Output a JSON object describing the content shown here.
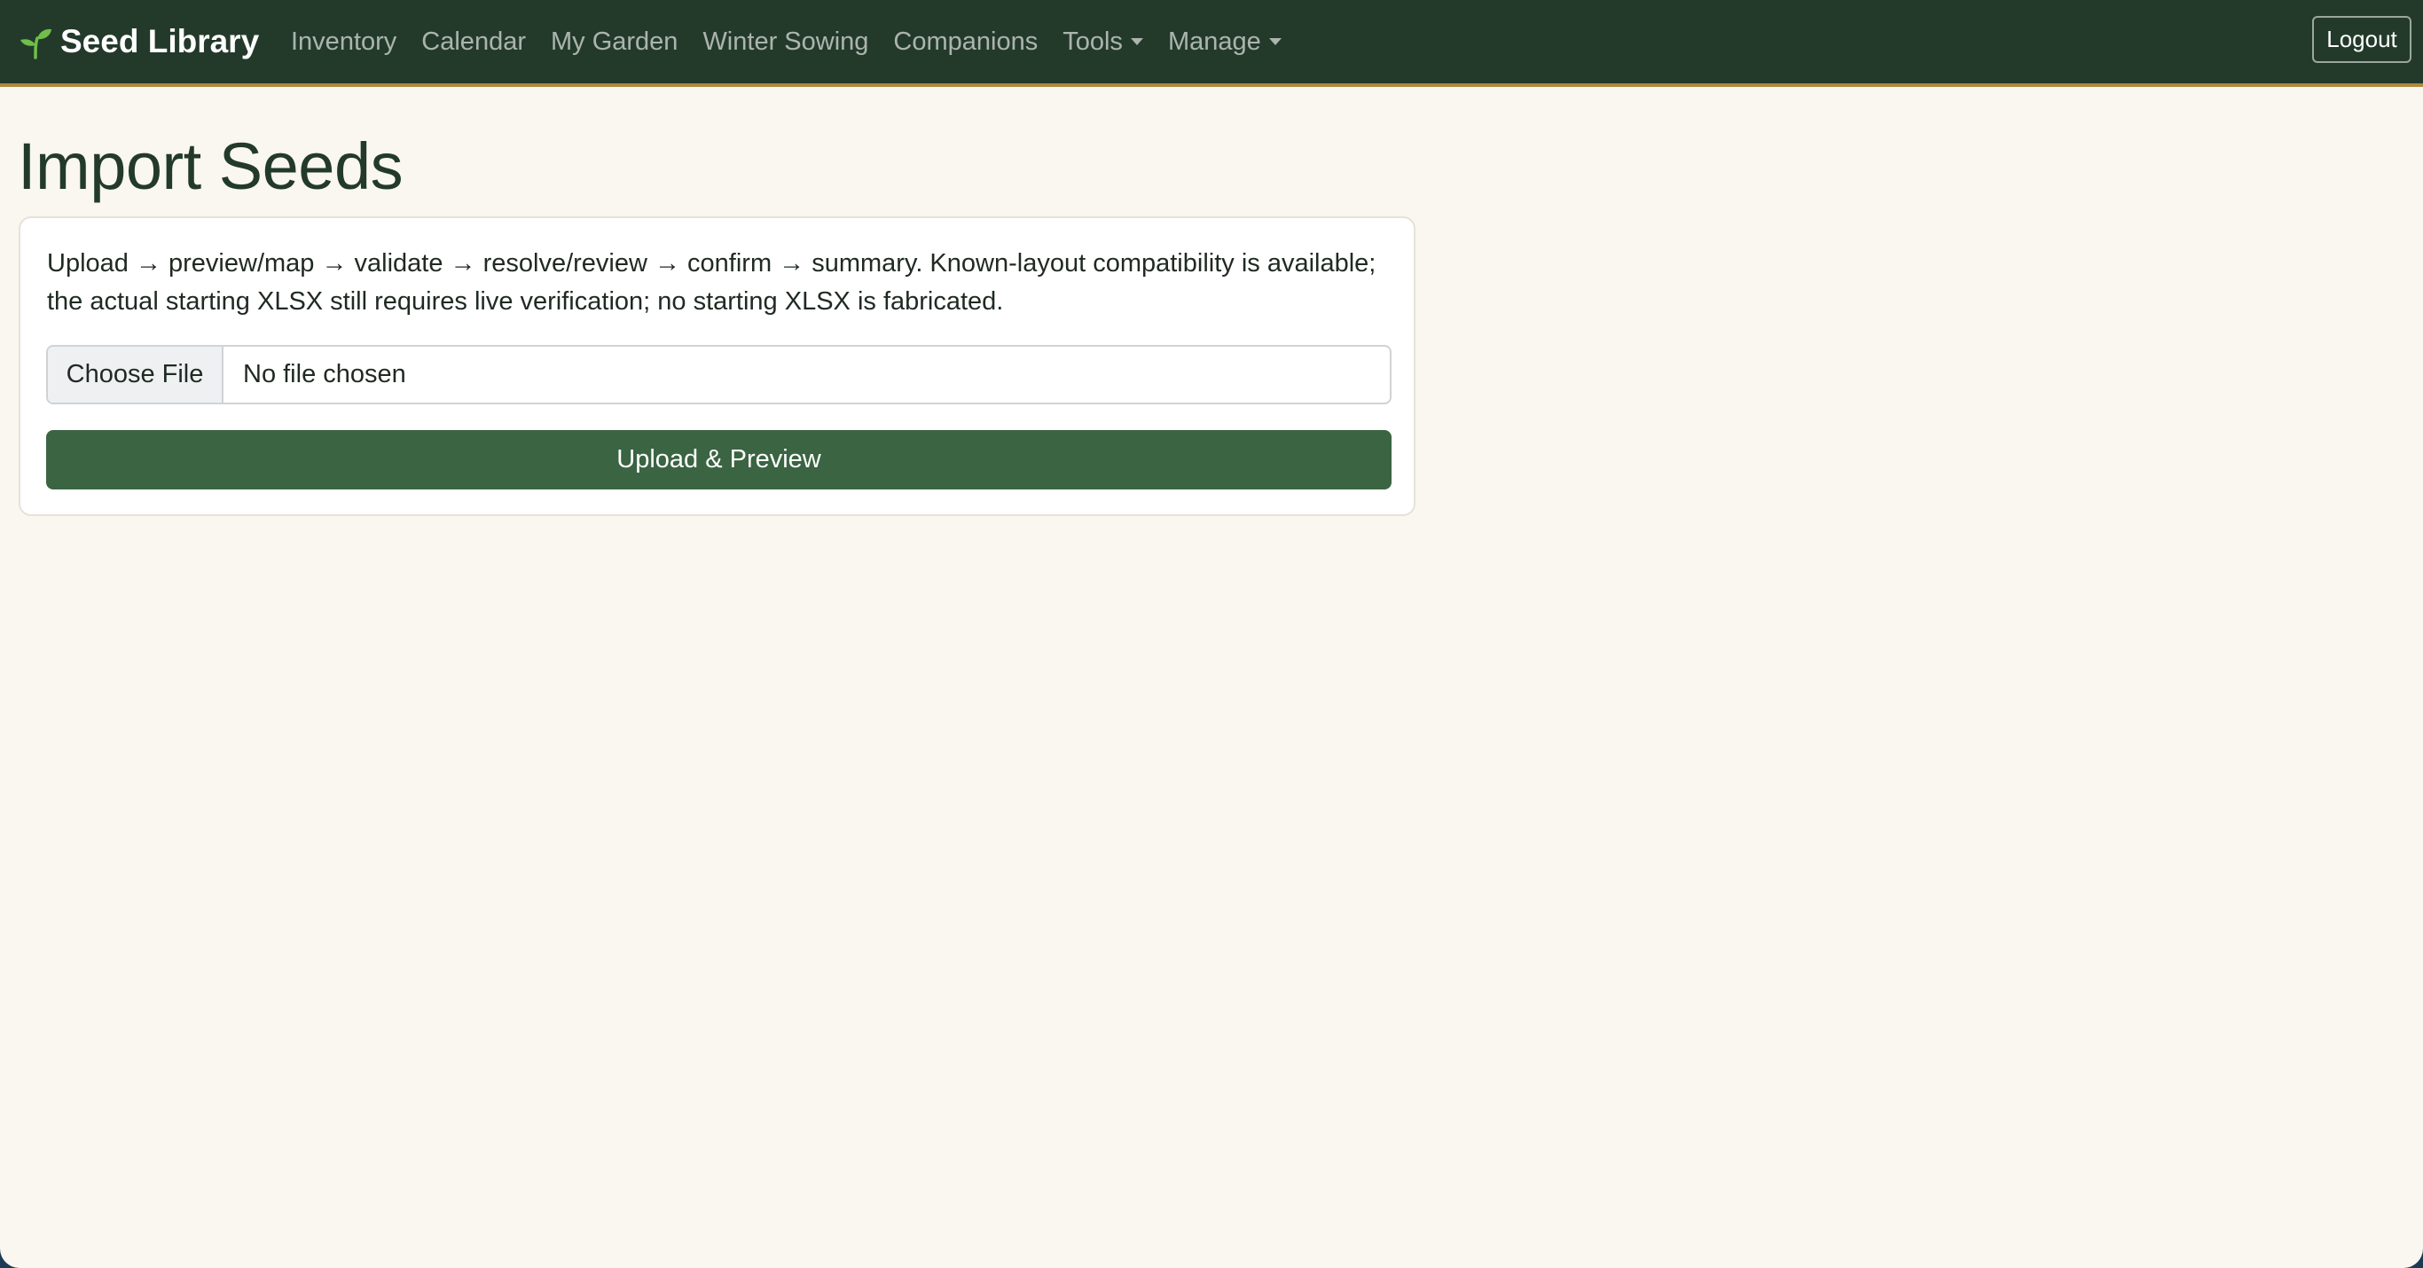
{
  "brand": {
    "name": "Seed Library",
    "icon": "seedling-icon",
    "icon_color": "#6fbf4a"
  },
  "nav": {
    "items": [
      {
        "label": "Inventory"
      },
      {
        "label": "Calendar"
      },
      {
        "label": "My Garden"
      },
      {
        "label": "Winter Sowing"
      },
      {
        "label": "Companions"
      },
      {
        "label": "Tools",
        "dropdown": true
      },
      {
        "label": "Manage",
        "dropdown": true
      }
    ],
    "logout_label": "Logout"
  },
  "page": {
    "title": "Import Seeds"
  },
  "card": {
    "description": "Upload → preview/map → validate → resolve/review → confirm → summary. Known-layout compatibility is available; the actual starting XLSX still requires live verification; no starting XLSX is fabricated.",
    "file_input": {
      "button_label": "Choose File",
      "status": "No file chosen"
    },
    "submit_label": "Upload & Preview"
  },
  "colors": {
    "navbar_bg": "#233a2b",
    "navbar_accent": "#b08a3e",
    "page_bg": "#f9f7f0",
    "primary_button": "#3a6442",
    "title_color": "#233a2b"
  }
}
